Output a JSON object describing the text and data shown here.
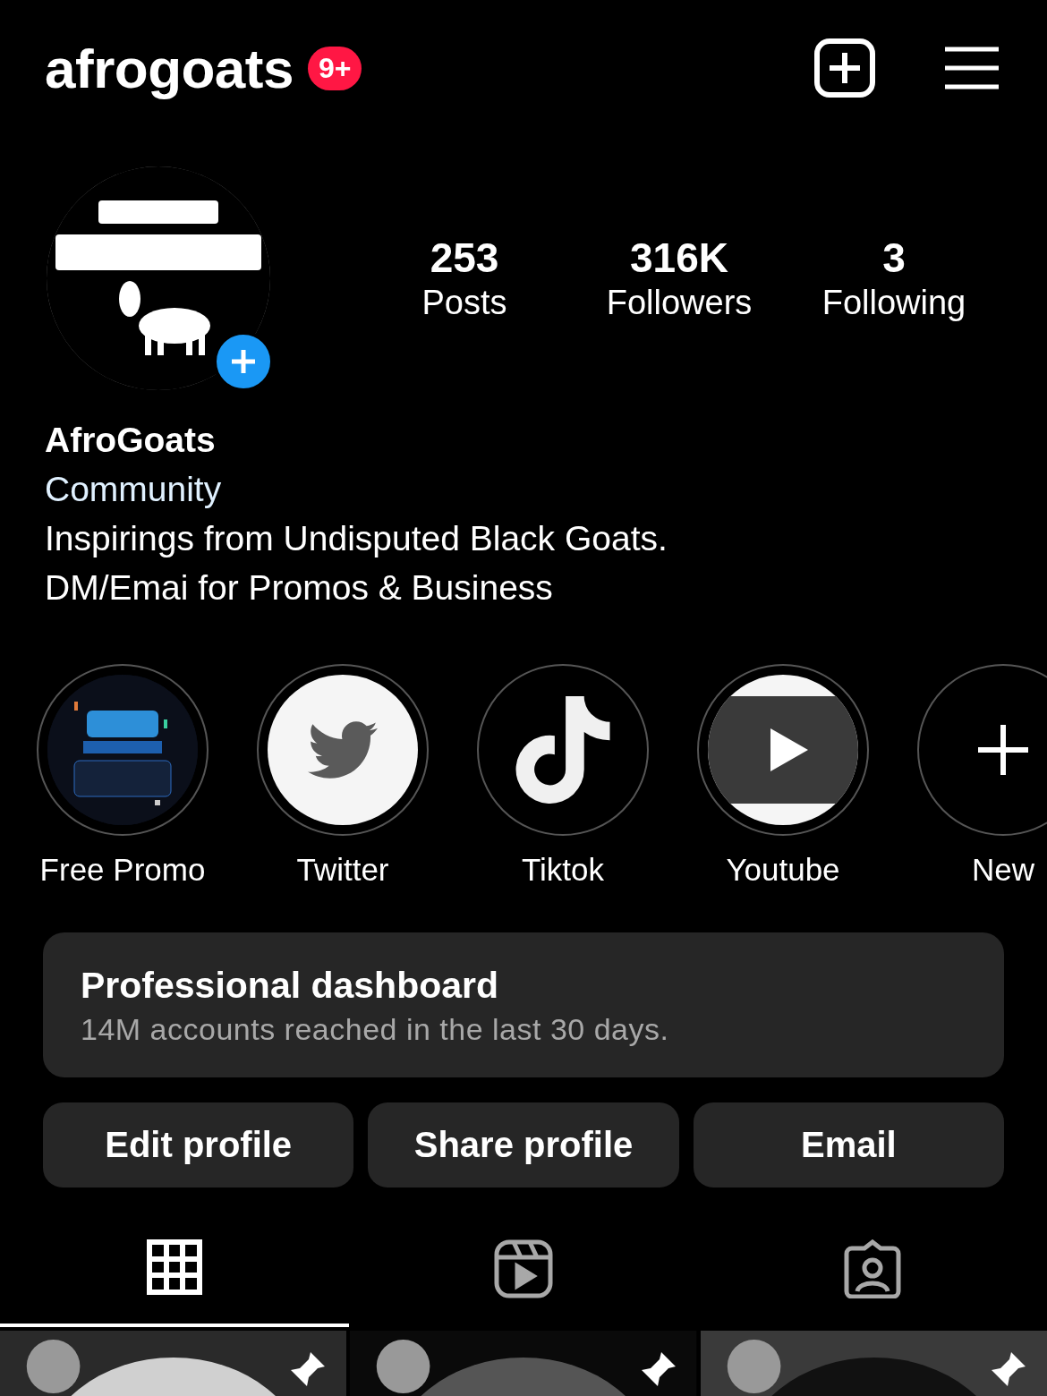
{
  "header": {
    "username": "afrogoats",
    "badge": "9+"
  },
  "profile": {
    "avatar": {
      "kind": "picture"
    },
    "stats": [
      {
        "value": "253",
        "label": "Posts"
      },
      {
        "value": "316K",
        "label": "Followers"
      },
      {
        "value": "3",
        "label": "Following"
      }
    ],
    "name": "AfroGoats",
    "category": "Community",
    "bio": [
      "Inspirings from Undisputed Black Goats.",
      "DM/Emai for Promos & Business"
    ]
  },
  "highlights": [
    {
      "kind": "picture",
      "label": "Free Promo"
    },
    {
      "kind": "twitter",
      "label": "Twitter"
    },
    {
      "kind": "tiktok",
      "label": "Tiktok"
    },
    {
      "kind": "youtube",
      "label": "Youtube"
    },
    {
      "kind": "new",
      "label": "New"
    }
  ],
  "dashboard": {
    "title": "Professional dashboard",
    "subtitle": "14M accounts reached in the last 30 days."
  },
  "buttons": [
    "Edit profile",
    "Share profile",
    "Email"
  ],
  "tabs": [
    {
      "kind": "grid",
      "selected": true
    },
    {
      "kind": "reels",
      "selected": false
    },
    {
      "kind": "tagged",
      "selected": false
    }
  ],
  "posts": [
    {
      "kind": "picture",
      "pinned": true
    },
    {
      "kind": "picture",
      "pinned": true
    },
    {
      "kind": "picture",
      "pinned": true
    }
  ]
}
